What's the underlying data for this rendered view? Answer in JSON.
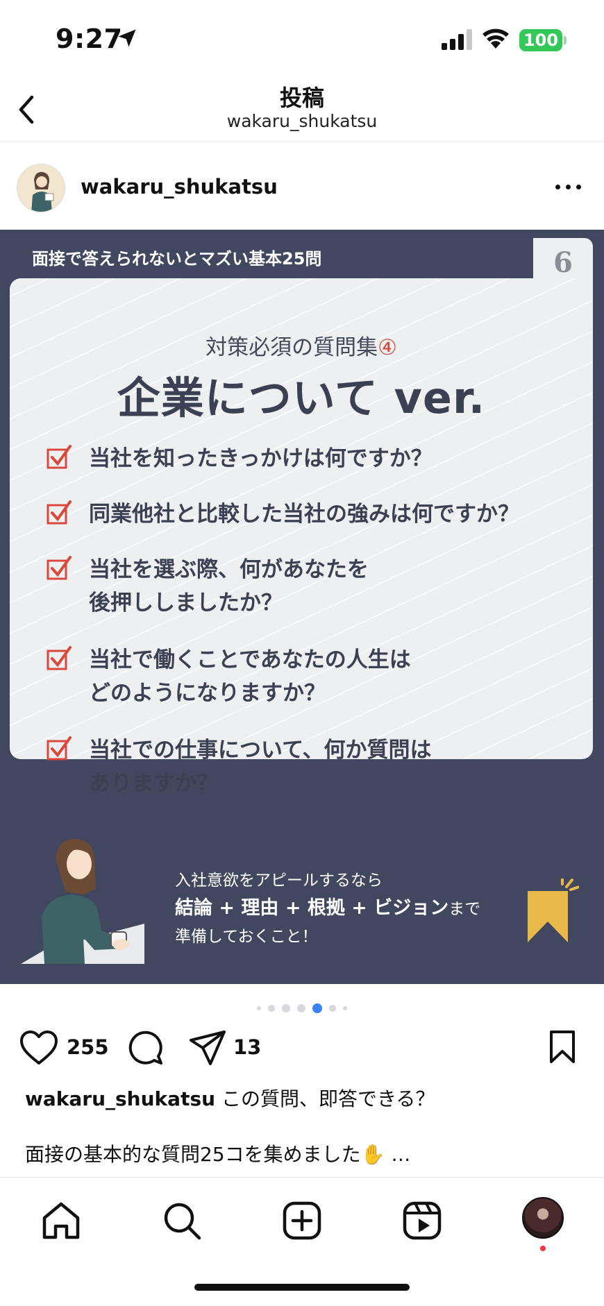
{
  "status_bar": {
    "time": "9:27",
    "battery": "100"
  },
  "header": {
    "title": "投稿",
    "subtitle": "wakaru_shukatsu"
  },
  "post": {
    "username": "wakaru_shukatsu",
    "image": {
      "series_title": "面接で答えられないとマズい基本25問",
      "page_number": "6",
      "subtitle": "対策必須の質問集",
      "subtitle_mark": "④",
      "headline": "企業について ver.",
      "questions": [
        {
          "line1": "当社を知ったきっかけは何ですか？",
          "line2": ""
        },
        {
          "line1": "同業他社と比較した当社の強みは何ですか？",
          "line2": ""
        },
        {
          "line1": "当社を選ぶ際、何があなたを",
          "line2": "後押ししましたか？"
        },
        {
          "line1": "当社で働くことであなたの人生は",
          "line2": "どのようになりますか？"
        },
        {
          "line1": "当社での仕事について、何か質問は",
          "line2": "ありますか？"
        }
      ],
      "tip_line1": "入社意欲をアピールするなら",
      "tip_bold": "結論 + 理由 + 根拠 + ビジョン",
      "tip_after_bold": "まで",
      "tip_line3": "準備しておくこと！"
    },
    "carousel": {
      "total": 7,
      "active": 4
    },
    "likes": "255",
    "shares": "13",
    "caption_user": "wakaru_shukatsu",
    "caption_text": "この質問、即答できる？",
    "caption_line2": "面接の基本的な質問25コを集めました✋ …"
  },
  "icons": {
    "back": "chevron-left-icon",
    "more": "more-horizontal-icon",
    "like": "heart-icon",
    "comment": "comment-icon",
    "share": "send-icon",
    "save": "bookmark-icon",
    "tabs": [
      "home-icon",
      "search-icon",
      "create-icon",
      "reels-icon",
      "profile-avatar"
    ]
  },
  "colors": {
    "slide_bg": "#40475e",
    "card_bg": "#eeeff1",
    "check": "#d9483b",
    "accent_dot": "#3b82f6",
    "battery": "#34c759"
  }
}
